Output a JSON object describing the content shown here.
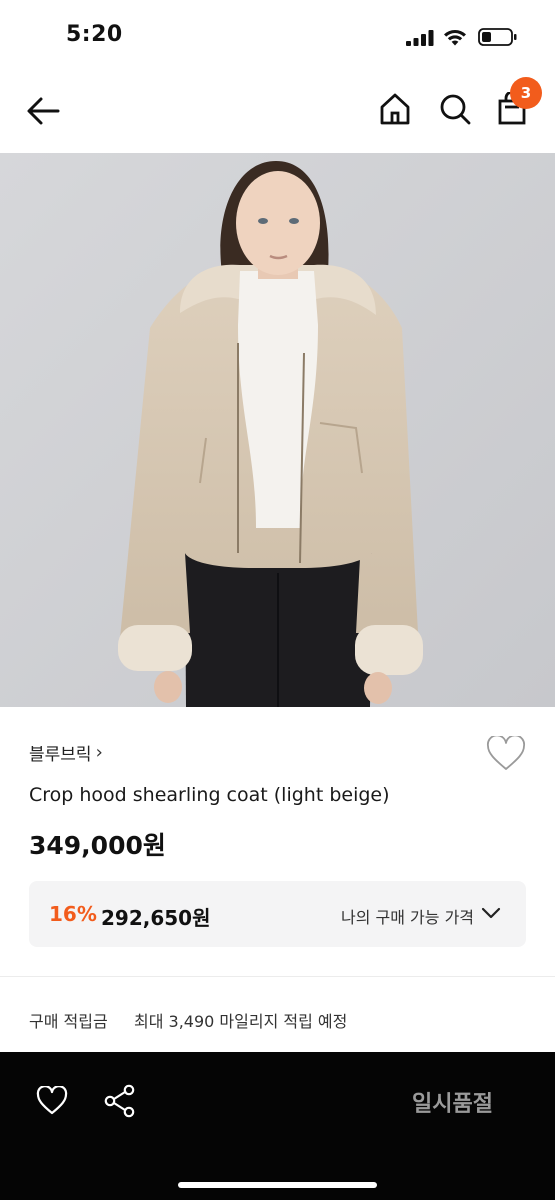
{
  "status_bar": {
    "time": "5:20"
  },
  "nav": {
    "icons": [
      "back-arrow-icon",
      "home-icon",
      "search-icon",
      "shopping-bag-icon"
    ],
    "cart_count": "3"
  },
  "product": {
    "image_description_icon": "product-photo",
    "brand": "블루브릭",
    "brand_chevron": "›",
    "name": "Crop hood shearling coat (light beige)",
    "price": "349,000원",
    "discount": {
      "rate": "16%",
      "price": "292,650원",
      "label": "나의 구매 가능 가격"
    },
    "points": {
      "label": "구매 적립금",
      "value": "최대 3,490 마일리지 적립 예정"
    }
  },
  "bottom_bar": {
    "sold_out_label": "일시품절"
  },
  "colors": {
    "accent": "#f25c1c",
    "bottom_bar_bg": "#050505",
    "price_box_bg": "#f4f4f5"
  }
}
